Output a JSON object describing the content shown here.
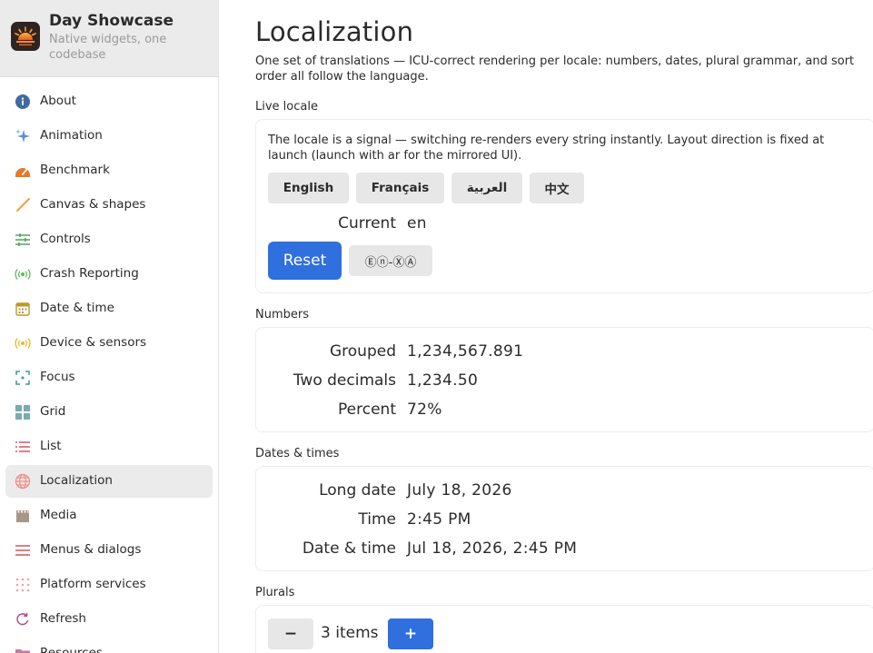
{
  "app": {
    "title": "Day Showcase",
    "subtitle": "Native widgets, one codebase"
  },
  "sidebar": {
    "items": [
      {
        "label": "About",
        "icon": "info-icon",
        "color": "#3f6aa5"
      },
      {
        "label": "Animation",
        "icon": "sparkle-icon",
        "color": "#5b8fe0"
      },
      {
        "label": "Benchmark",
        "icon": "speedometer-icon",
        "color": "#e8782a"
      },
      {
        "label": "Canvas & shapes",
        "icon": "brush-icon",
        "color": "#f0a34a"
      },
      {
        "label": "Controls",
        "icon": "sliders-icon",
        "color": "#4a9a5a"
      },
      {
        "label": "Crash Reporting",
        "icon": "broadcast-icon",
        "color": "#5bb85b"
      },
      {
        "label": "Date & time",
        "icon": "calendar-icon",
        "color": "#b89a2a"
      },
      {
        "label": "Device & sensors",
        "icon": "sensor-icon",
        "color": "#e6b822"
      },
      {
        "label": "Focus",
        "icon": "focus-icon",
        "color": "#3a9a9a"
      },
      {
        "label": "Grid",
        "icon": "grid-icon",
        "color": "#7aaab2"
      },
      {
        "label": "List",
        "icon": "list-icon",
        "color": "#d9434e"
      },
      {
        "label": "Localization",
        "icon": "globe-icon",
        "color": "#f08a80",
        "active": true
      },
      {
        "label": "Media",
        "icon": "film-icon",
        "color": "#a99588"
      },
      {
        "label": "Menus & dialogs",
        "icon": "menu-icon",
        "color": "#d9434e"
      },
      {
        "label": "Platform services",
        "icon": "dots-grid-icon",
        "color": "#f0a4a4"
      },
      {
        "label": "Refresh",
        "icon": "refresh-icon",
        "color": "#b44a8a"
      },
      {
        "label": "Resources",
        "icon": "folder-icon",
        "color": "#c77aa8"
      }
    ]
  },
  "page": {
    "title": "Localization",
    "description": "One set of translations — ICU-correct rendering per locale: numbers, dates, plural grammar, and sort order all follow the language."
  },
  "live_locale": {
    "label": "Live locale",
    "note": "The locale is a signal — switching re-renders every string instantly. Layout direction is fixed at launch (launch with ar for the mirrored UI).",
    "languages": [
      "English",
      "Français",
      "العربية",
      "中文"
    ],
    "current_key": "Current",
    "current_value": "en",
    "reset_label": "Reset",
    "pseudo_label": "Ⓔⓝ-ⓍⒶ"
  },
  "numbers": {
    "label": "Numbers",
    "rows": [
      {
        "key": "Grouped",
        "value": "1,234,567.891"
      },
      {
        "key": "Two decimals",
        "value": "1,234.50"
      },
      {
        "key": "Percent",
        "value": "72%"
      }
    ]
  },
  "dates": {
    "label": "Dates & times",
    "rows": [
      {
        "key": "Long date",
        "value": "July 18, 2026"
      },
      {
        "key": "Time",
        "value": "2:45 PM"
      },
      {
        "key": "Date & time",
        "value": "Jul 18, 2026, 2:45 PM"
      }
    ]
  },
  "plurals": {
    "label": "Plurals",
    "minus_label": "−",
    "count_text": "3 items",
    "plus_label": "+"
  },
  "colors": {
    "accent": "#2f6fde",
    "button_gray": "#e7e7e7",
    "sidebar_header": "#ebebeb"
  }
}
